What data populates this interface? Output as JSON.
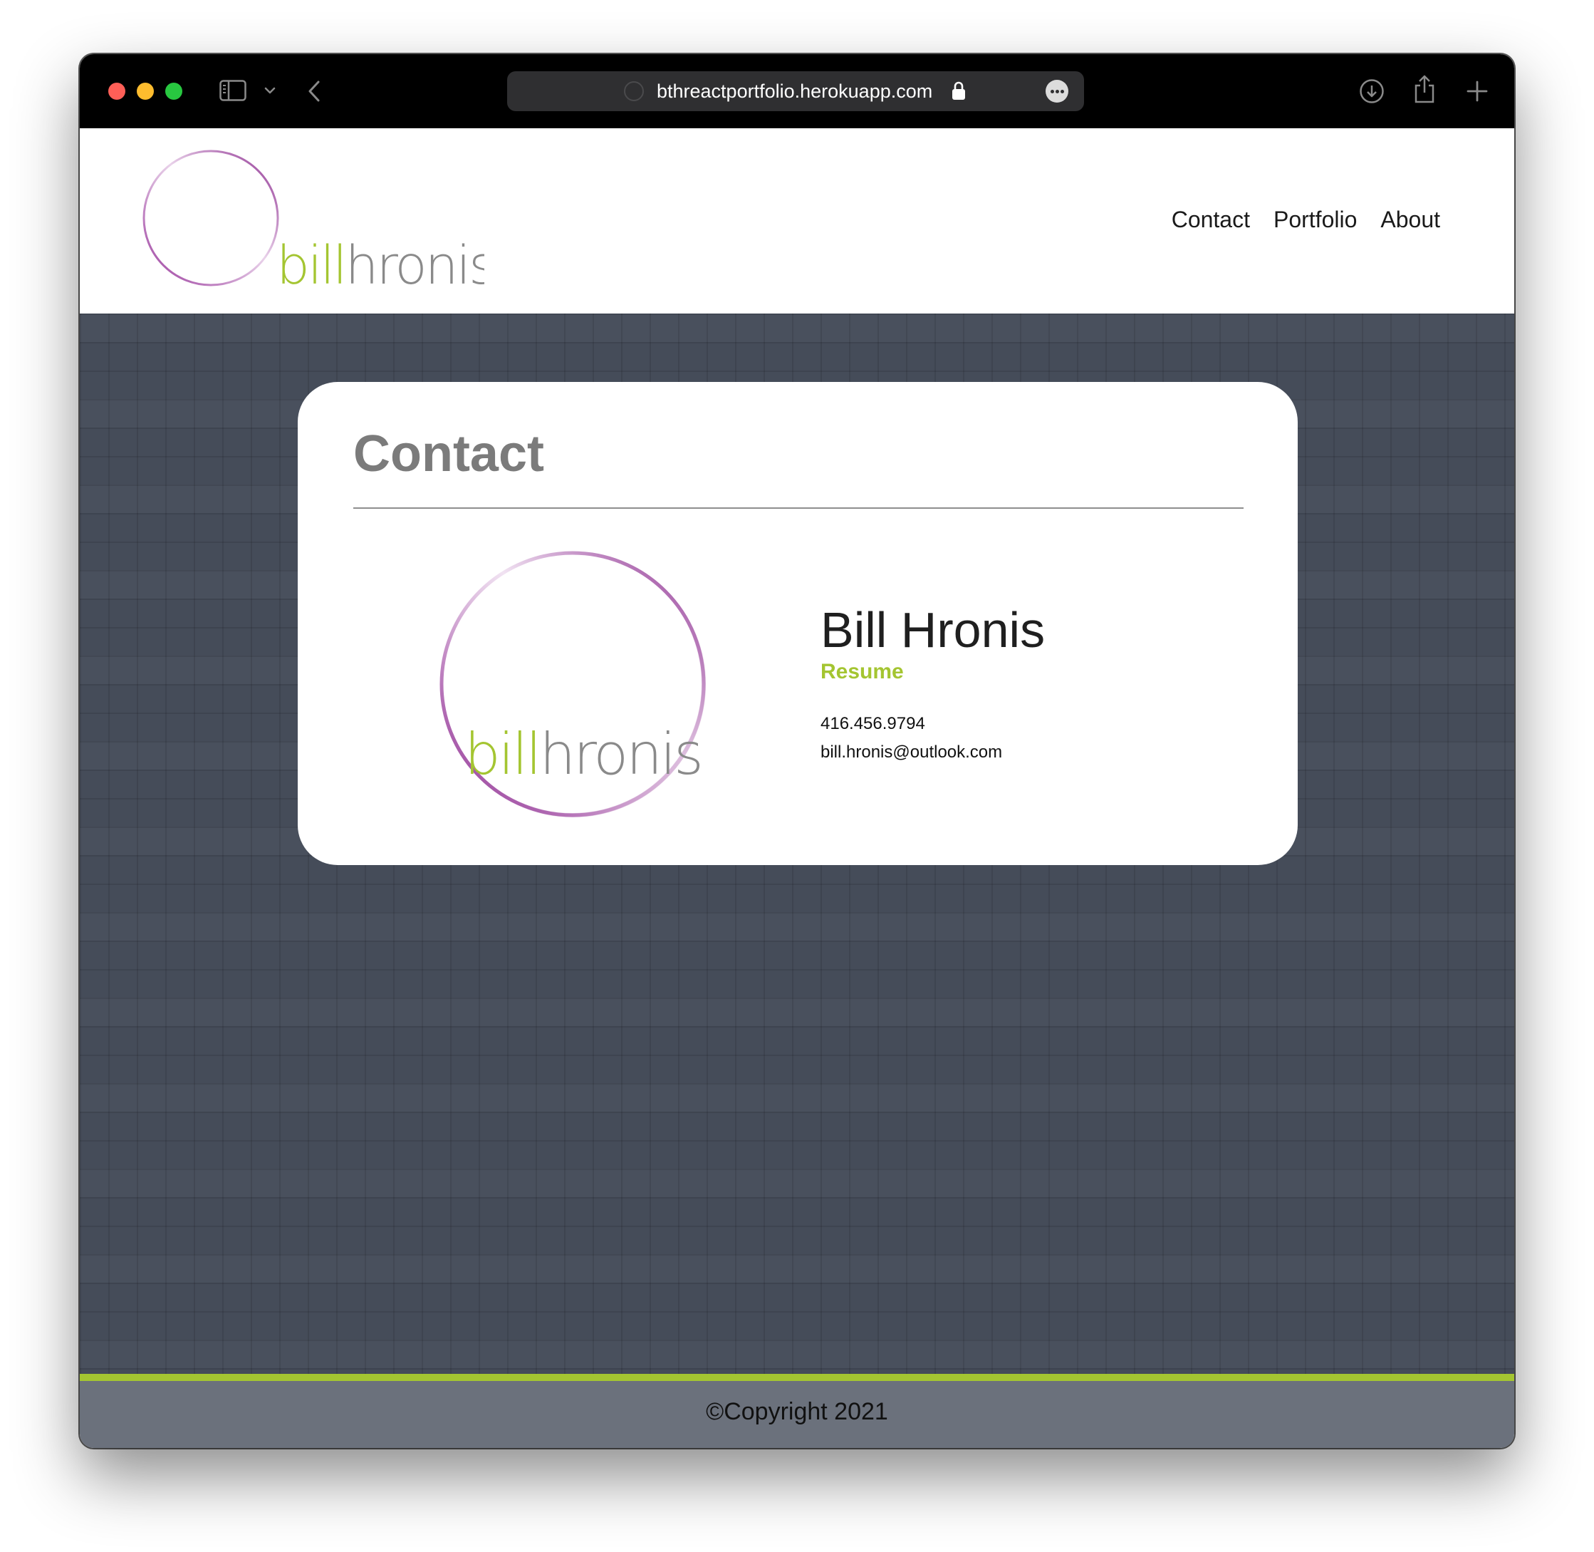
{
  "browser": {
    "url": "bthreactportfolio.herokuapp.com",
    "icons": [
      "sidebar-icon",
      "chevron-down-icon",
      "back-icon",
      "lock-icon",
      "more-icon",
      "download-icon",
      "share-icon",
      "new-tab-icon"
    ]
  },
  "header": {
    "logo": {
      "first": "bill",
      "last": "hronis"
    },
    "nav": [
      {
        "label": "Contact"
      },
      {
        "label": "Portfolio"
      },
      {
        "label": "About"
      }
    ]
  },
  "contact": {
    "title": "Contact",
    "name": "Bill Hronis",
    "resume_label": "Resume",
    "phone": "416.456.9794",
    "email": "bill.hronis@outlook.com"
  },
  "footer": {
    "copyright": "©Copyright 2021"
  },
  "colors": {
    "accent_green": "#a4c531",
    "accent_purple": "#8e2f91",
    "background": "#454c59",
    "footer": "#6b717c"
  }
}
